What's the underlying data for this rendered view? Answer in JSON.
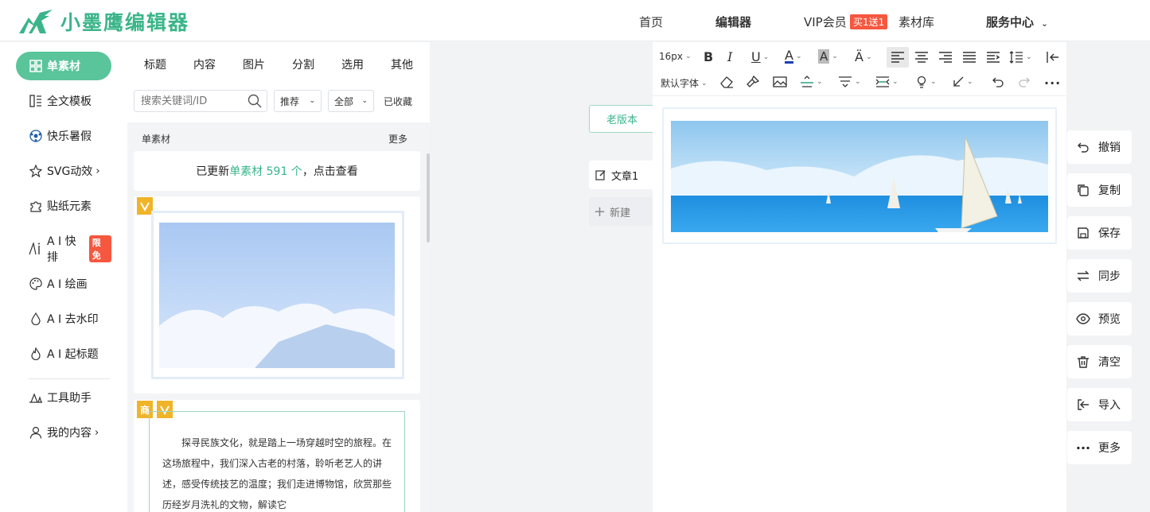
{
  "brand": {
    "name": "小墨鹰编辑器",
    "color": "#3ab58a"
  },
  "nav": {
    "home": "首页",
    "editor": "编辑器",
    "vip": "VIP会员",
    "vip_badge": "买1送1",
    "library": "素材库",
    "service": "服务中心"
  },
  "sidebar": {
    "items": [
      {
        "label": "单素材",
        "icon": "grid-icon"
      },
      {
        "label": "全文模板",
        "icon": "template-icon"
      },
      {
        "label": "快乐暑假",
        "icon": "ball-icon"
      },
      {
        "label": "SVG动效",
        "icon": "star-icon"
      },
      {
        "label": "贴纸元素",
        "icon": "puzzle-icon"
      },
      {
        "label": "A I 快排",
        "icon": "ai-icon",
        "badge": "限免"
      },
      {
        "label": "A I 绘画",
        "icon": "palette-icon"
      },
      {
        "label": "A I 去水印",
        "icon": "drop-icon"
      },
      {
        "label": "A I 起标题",
        "icon": "flame-icon"
      },
      {
        "label": "工具助手",
        "icon": "tools-icon"
      },
      {
        "label": "我的内容",
        "icon": "user-icon"
      }
    ]
  },
  "panel": {
    "tabs": [
      "标题",
      "内容",
      "图片",
      "分割",
      "选用",
      "其他"
    ],
    "search_placeholder": "搜索关键词/ID",
    "filter_sort": "推荐",
    "filter_scope": "全部",
    "collected": "已收藏",
    "section_title": "单素材",
    "section_more": "更多",
    "update_prefix": "已更新",
    "update_highlight": "单素材 591 个",
    "update_suffix": "，点击查看",
    "badge_commercial": "商",
    "text_card": "探寻民族文化，就是踏上一场穿越时空的旅程。在这场旅程中，我们深入古老的村落，聆听老艺人的讲述，感受传统技艺的温度；我们走进博物馆，欣赏那些历经岁月洗礼的文物，解读它"
  },
  "middle": {
    "old_version": "老版本",
    "doc_tab": "文章1",
    "new_tab": "新建"
  },
  "toolbar": {
    "font_size": "16px",
    "font_family": "默认字体"
  },
  "actions": [
    "撤销",
    "复制",
    "保存",
    "同步",
    "预览",
    "清空",
    "导入",
    "更多"
  ],
  "colors": {
    "accent": "#5ac49b",
    "badge_red": "#f5573f",
    "highlight": "#3ab58a"
  }
}
